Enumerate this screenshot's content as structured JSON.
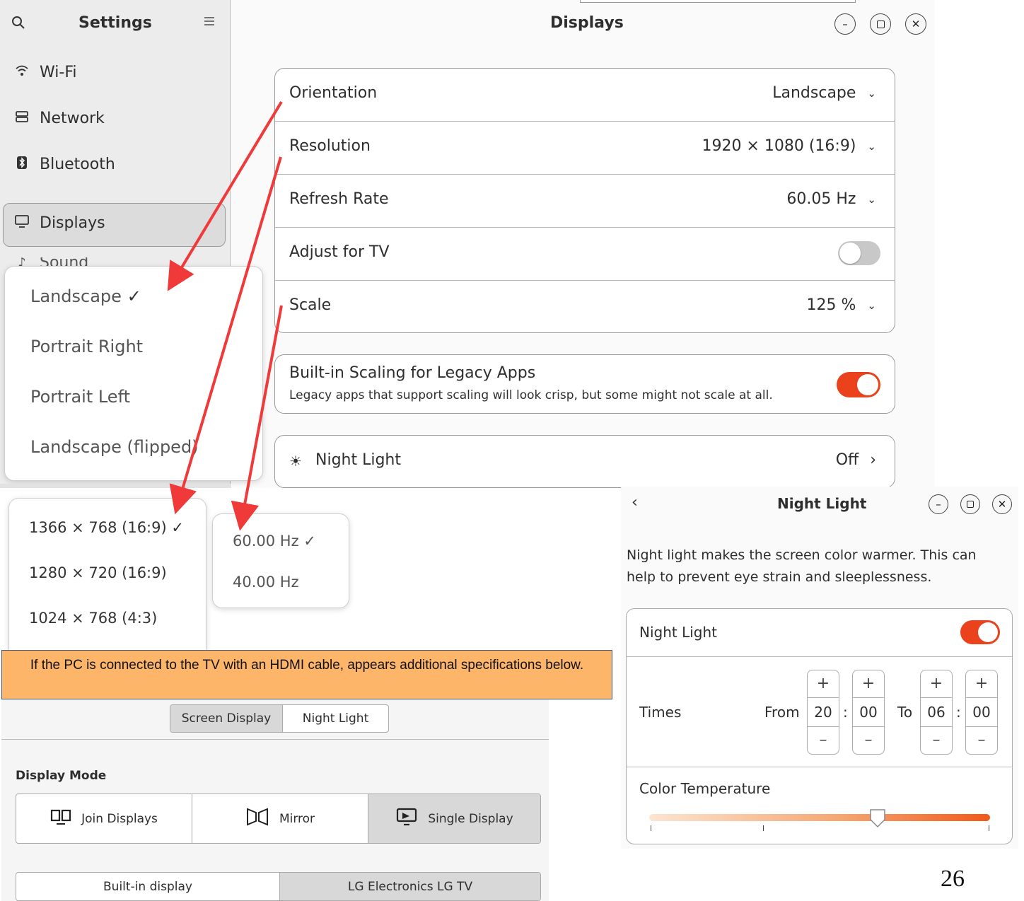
{
  "sidebar": {
    "title": "Settings",
    "items": [
      {
        "label": "Wi-Fi",
        "icon": "wifi-icon"
      },
      {
        "label": "Network",
        "icon": "network-icon"
      },
      {
        "label": "Bluetooth",
        "icon": "bluetooth-icon"
      },
      {
        "label": "Displays",
        "icon": "display-icon"
      },
      {
        "label": "Sound",
        "icon": "sound-icon"
      }
    ]
  },
  "main": {
    "title": "Displays",
    "rows": [
      {
        "label": "Orientation",
        "value": "Landscape"
      },
      {
        "label": "Resolution",
        "value": "1920 × 1080 (16:9)"
      },
      {
        "label": "Refresh Rate",
        "value": "60.05 Hz"
      },
      {
        "label": "Adjust for TV",
        "toggle": "off"
      },
      {
        "label": "Scale",
        "value": "125 %"
      }
    ],
    "legacy": {
      "title": "Built-in Scaling for Legacy Apps",
      "subtitle": "Legacy apps that support scaling will look crisp, but some might not scale at all.",
      "toggle": "on"
    },
    "night_light_row": {
      "label": "Night Light",
      "value": "Off"
    }
  },
  "orientation_popover": {
    "items": [
      "Landscape",
      "Portrait Right",
      "Portrait Left",
      "Landscape (flipped)"
    ],
    "selected": "Landscape"
  },
  "resolution_popover": {
    "items": [
      "1366 × 768 (16:9)",
      "1280 × 720 (16:9)",
      "1024 × 768 (4:3)"
    ],
    "selected": "1366 × 768 (16:9)"
  },
  "refresh_popover": {
    "items": [
      "60.00 Hz",
      "40.00 Hz"
    ],
    "selected": "60.00 Hz"
  },
  "night_light_window": {
    "title": "Night Light",
    "description": "Night light makes the screen color warmer. This can help to prevent eye strain and sleeplessness.",
    "toggle_label": "Night Light",
    "times_label": "Times",
    "from_label": "From",
    "to_label": "To",
    "from_hour": "20",
    "from_min": "00",
    "to_hour": "06",
    "to_min": "00",
    "separator": ":",
    "plus": "+",
    "minus": "–",
    "color_temp_label": "Color Temperature",
    "slider_fraction": 0.67
  },
  "note": "If the PC is connected to the TV with an HDMI cable, appears additional specifications below.",
  "bottom_panel": {
    "tabs": [
      "Screen Display",
      "Night Light"
    ],
    "display_mode_label": "Display Mode",
    "modes": [
      "Join Displays",
      "Mirror",
      "Single Display"
    ],
    "selected_mode": "Single Display",
    "displays": [
      "Built-in display",
      "LG Electronics LG TV"
    ]
  },
  "page_number": "26",
  "colors": {
    "accent": "#e9421d",
    "arrow": "#f03a3a",
    "note_bg": "#fdb56a"
  }
}
